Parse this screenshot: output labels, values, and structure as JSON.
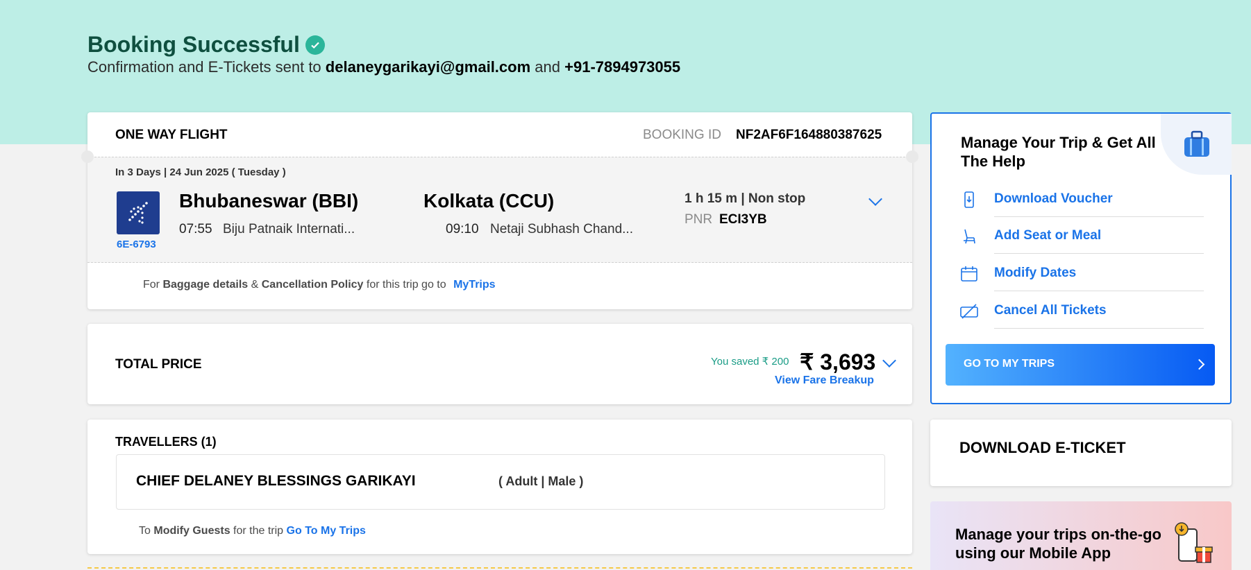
{
  "header": {
    "title": "Booking Successful",
    "sub_prefix": "Confirmation and E-Tickets sent to",
    "email": "delaneygarikayi@gmail.com",
    "sub_and": "and",
    "phone": "+91-7894973055"
  },
  "flight": {
    "type_label": "ONE WAY FLIGHT",
    "booking_id_label": "BOOKING ID",
    "booking_id": "NF2AF6F164880387625",
    "date": "In 3 Days | 24 Jun 2025 ( Tuesday )",
    "flight_number": "6E-6793",
    "from_city": "Bhubaneswar (BBI)",
    "from_time": "07:55",
    "from_airport": "Biju Patnaik Internati...",
    "to_city": "Kolkata (CCU)",
    "to_time": "09:10",
    "to_airport": "Netaji Subhash Chand...",
    "duration": "1 h 15 m | Non stop",
    "pnr_label": "PNR",
    "pnr": "ECI3YB",
    "note_for": "For",
    "note_baggage": "Baggage details",
    "note_amp": "&",
    "note_cancel": "Cancellation Policy",
    "note_trip": "for this trip go to",
    "note_link": "MyTrips"
  },
  "price": {
    "label": "TOTAL PRICE",
    "saved": "You saved ₹ 200",
    "amount": "₹ 3,693",
    "breakup_link": "View Fare Breakup"
  },
  "travellers": {
    "heading": "TRAVELLERS (1)",
    "name": "CHIEF DELANEY BLESSINGS GARIKAYI",
    "type": "( Adult | Male )",
    "note_to": "To",
    "note_modify": "Modify Guests",
    "note_trip": "for the trip",
    "note_link": "Go To My Trips"
  },
  "manage": {
    "title": "Manage Your Trip & Get All The Help",
    "items": [
      {
        "label": "Download Voucher",
        "icon": "voucher-icon"
      },
      {
        "label": "Add Seat or Meal",
        "icon": "seat-icon"
      },
      {
        "label": "Modify Dates",
        "icon": "calendar-icon"
      },
      {
        "label": "Cancel All Tickets",
        "icon": "cancel-ticket-icon"
      }
    ],
    "button": "GO TO MY TRIPS"
  },
  "eticket": {
    "label": "DOWNLOAD E-TICKET"
  },
  "app_promo": {
    "label": "Manage your trips on-the-go using our Mobile App"
  },
  "colors": {
    "accent": "#1a73e8",
    "hero_bg": "#bdeee6",
    "success": "#2bb59a"
  }
}
